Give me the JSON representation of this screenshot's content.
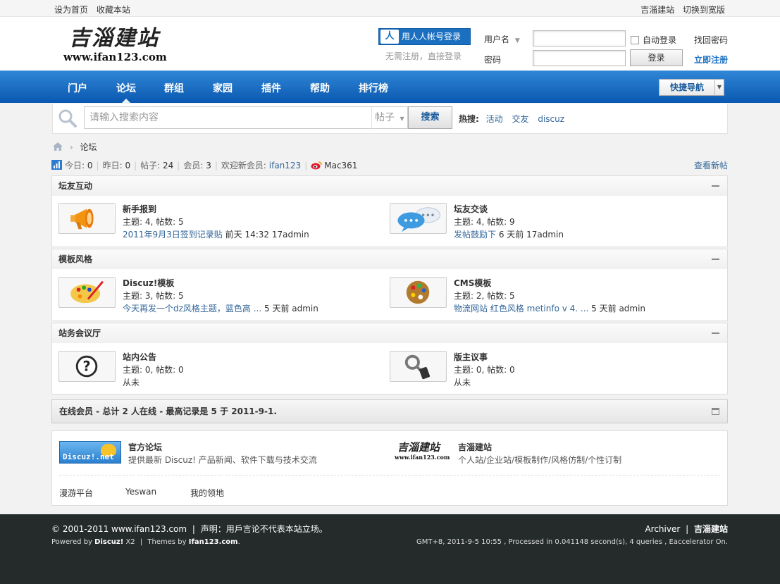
{
  "topbar": {
    "set_home": "设为首页",
    "bookmark": "收藏本站",
    "site_name": "吉淄建站",
    "switch_wide": "切换到宽版"
  },
  "header": {
    "logo_cn": "吉淄建站",
    "logo_url": "www.ifan123.com",
    "renren_login": "用人人帐号登录",
    "no_register": "无需注册，直接登录",
    "username_label": "用户名",
    "password_label": "密码",
    "auto_login": "自动登录",
    "login_button": "登录",
    "find_password": "找回密码",
    "register_now": "立即注册"
  },
  "nav": {
    "items": [
      "门户",
      "论坛",
      "群组",
      "家园",
      "插件",
      "帮助",
      "排行榜"
    ],
    "active_index": 1,
    "quick_nav": "快捷导航"
  },
  "search": {
    "placeholder": "请输入搜索内容",
    "type": "帖子",
    "button": "搜索",
    "hot_label": "热搜:",
    "hot_terms": [
      "活动",
      "交友",
      "discuz"
    ]
  },
  "breadcrumb": {
    "current": "论坛"
  },
  "stats": {
    "today_label": "今日:",
    "today": "0",
    "yesterday_label": "昨日:",
    "yesterday": "0",
    "posts_label": "帖子:",
    "posts": "24",
    "members_label": "会员:",
    "members": "3",
    "welcome_label": "欢迎新会员:",
    "new_member": "ifan123",
    "weibo_user": "Mac361",
    "view_new": "查看新帖"
  },
  "categories": [
    {
      "title": "坛友互动",
      "forums": [
        {
          "name": "新手报到",
          "stats": "主题: 4, 帖数: 5",
          "last_link": "2011年9月3日签到记录贴",
          "last_meta": " 前天 14:32 17admin"
        },
        {
          "name": "坛友交谈",
          "stats": "主题: 4, 帖数: 9",
          "last_link": "发帖鼓励下",
          "last_meta": " 6 天前 17admin"
        }
      ]
    },
    {
      "title": "模板风格",
      "forums": [
        {
          "name": "Discuz!模板",
          "stats": "主题: 3, 帖数: 5",
          "last_link": "今天再发一个dz风格主题，蓝色高 ...",
          "last_meta": " 5 天前 admin"
        },
        {
          "name": "CMS模板",
          "stats": "主题: 2, 帖数: 5",
          "last_link": "物流网站 红色风格 metinfo v 4. ...",
          "last_meta": " 5 天前 admin"
        }
      ]
    },
    {
      "title": "站务会议厅",
      "forums": [
        {
          "name": "站内公告",
          "stats": "主题: 0, 帖数: 0",
          "last_link": "",
          "last_meta": "从未"
        },
        {
          "name": "版主议事",
          "stats": "主题: 0, 帖数: 0",
          "last_link": "",
          "last_meta": "从未"
        }
      ]
    }
  ],
  "online": {
    "text": "在线会员 - 总计 2 人在线 - 最高记录是 5 于 2011-9-1."
  },
  "friend_links": {
    "dz_logo_text": "Discuz!.net",
    "dz_name": "官方论坛",
    "dz_desc": "提供最新 Discuz! 产品新闻、软件下载与技术交流",
    "site_logo_cn": "吉淄建站",
    "site_logo_url": "www.ifan123.com",
    "site_name": "吉淄建站",
    "site_desc": "个人站/企业站/模板制作/风格仿制/个性订制",
    "text_links": [
      "漫游平台",
      "Yeswan",
      "我的领地"
    ]
  },
  "footer": {
    "copyright": "© 2001-2011 www.ifan123.com",
    "statement": "声明：用戶言论不代表本站立场。",
    "powered_by": "Powered by",
    "powered_name": "Discuz!",
    "powered_ver": "X2",
    "themes_by": "Themes by",
    "themes_name": "Ifan123.com",
    "archiver": "Archiver",
    "site_name": "吉淄建站",
    "runtime": "GMT+8, 2011-9-5 10:55 , Processed in 0.041148 second(s), 4 queries , Eaccelerator On."
  }
}
